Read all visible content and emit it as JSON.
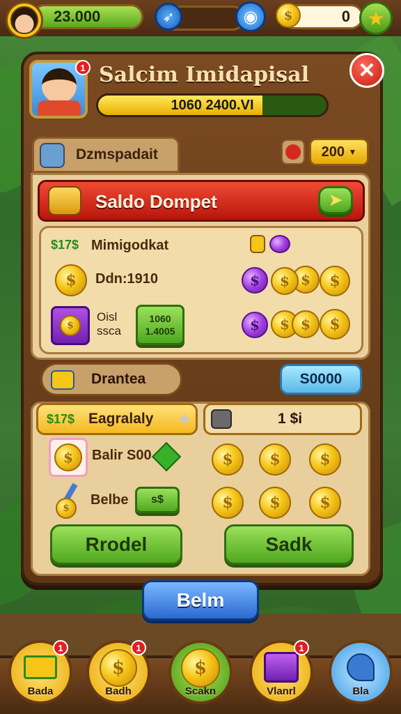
{
  "topbar": {
    "coins": "23.000",
    "gems": "0"
  },
  "header": {
    "title": "Salcim Imidapisal",
    "xp_text": "1060 2400.VI",
    "xp_progress": 0.72,
    "avatar_badge": "1"
  },
  "tabs": {
    "section_label": "Dzmspadait",
    "currency_value": "200"
  },
  "wallet": {
    "title": "Saldo Dompet",
    "row1_label": "Mimigodkat",
    "row1_code": "$17$",
    "row2_label": "Ddn:1910",
    "row3_line1": "Oisl",
    "row3_line2": "ssca",
    "row3_chip": "1060\n1.4005"
  },
  "drantea": {
    "label": "Drantea",
    "value": "S0000"
  },
  "lower": {
    "tab_label": "Eagralaly",
    "tab_code": "$17$",
    "amount": "1 $i",
    "row1_label": "Balir S00",
    "row2_label": "Belbe",
    "row2_chip": "s$"
  },
  "buttons": {
    "left": "Rrodel",
    "right": "Sadk",
    "center": "Belm"
  },
  "nav": [
    {
      "label": "Bada",
      "badge": "1"
    },
    {
      "label": "Badh",
      "badge": "1"
    },
    {
      "label": "Scakn",
      "badge": ""
    },
    {
      "label": "Vlanrl",
      "badge": "1"
    },
    {
      "label": "Bla",
      "badge": ""
    }
  ],
  "colors": {
    "wood": "#5e3616",
    "parchment": "#e9cf9c",
    "red_banner": "#d42a1e",
    "green": "#4fa81e",
    "blue_button": "#3a7ad8",
    "gold": "#f5c518"
  }
}
